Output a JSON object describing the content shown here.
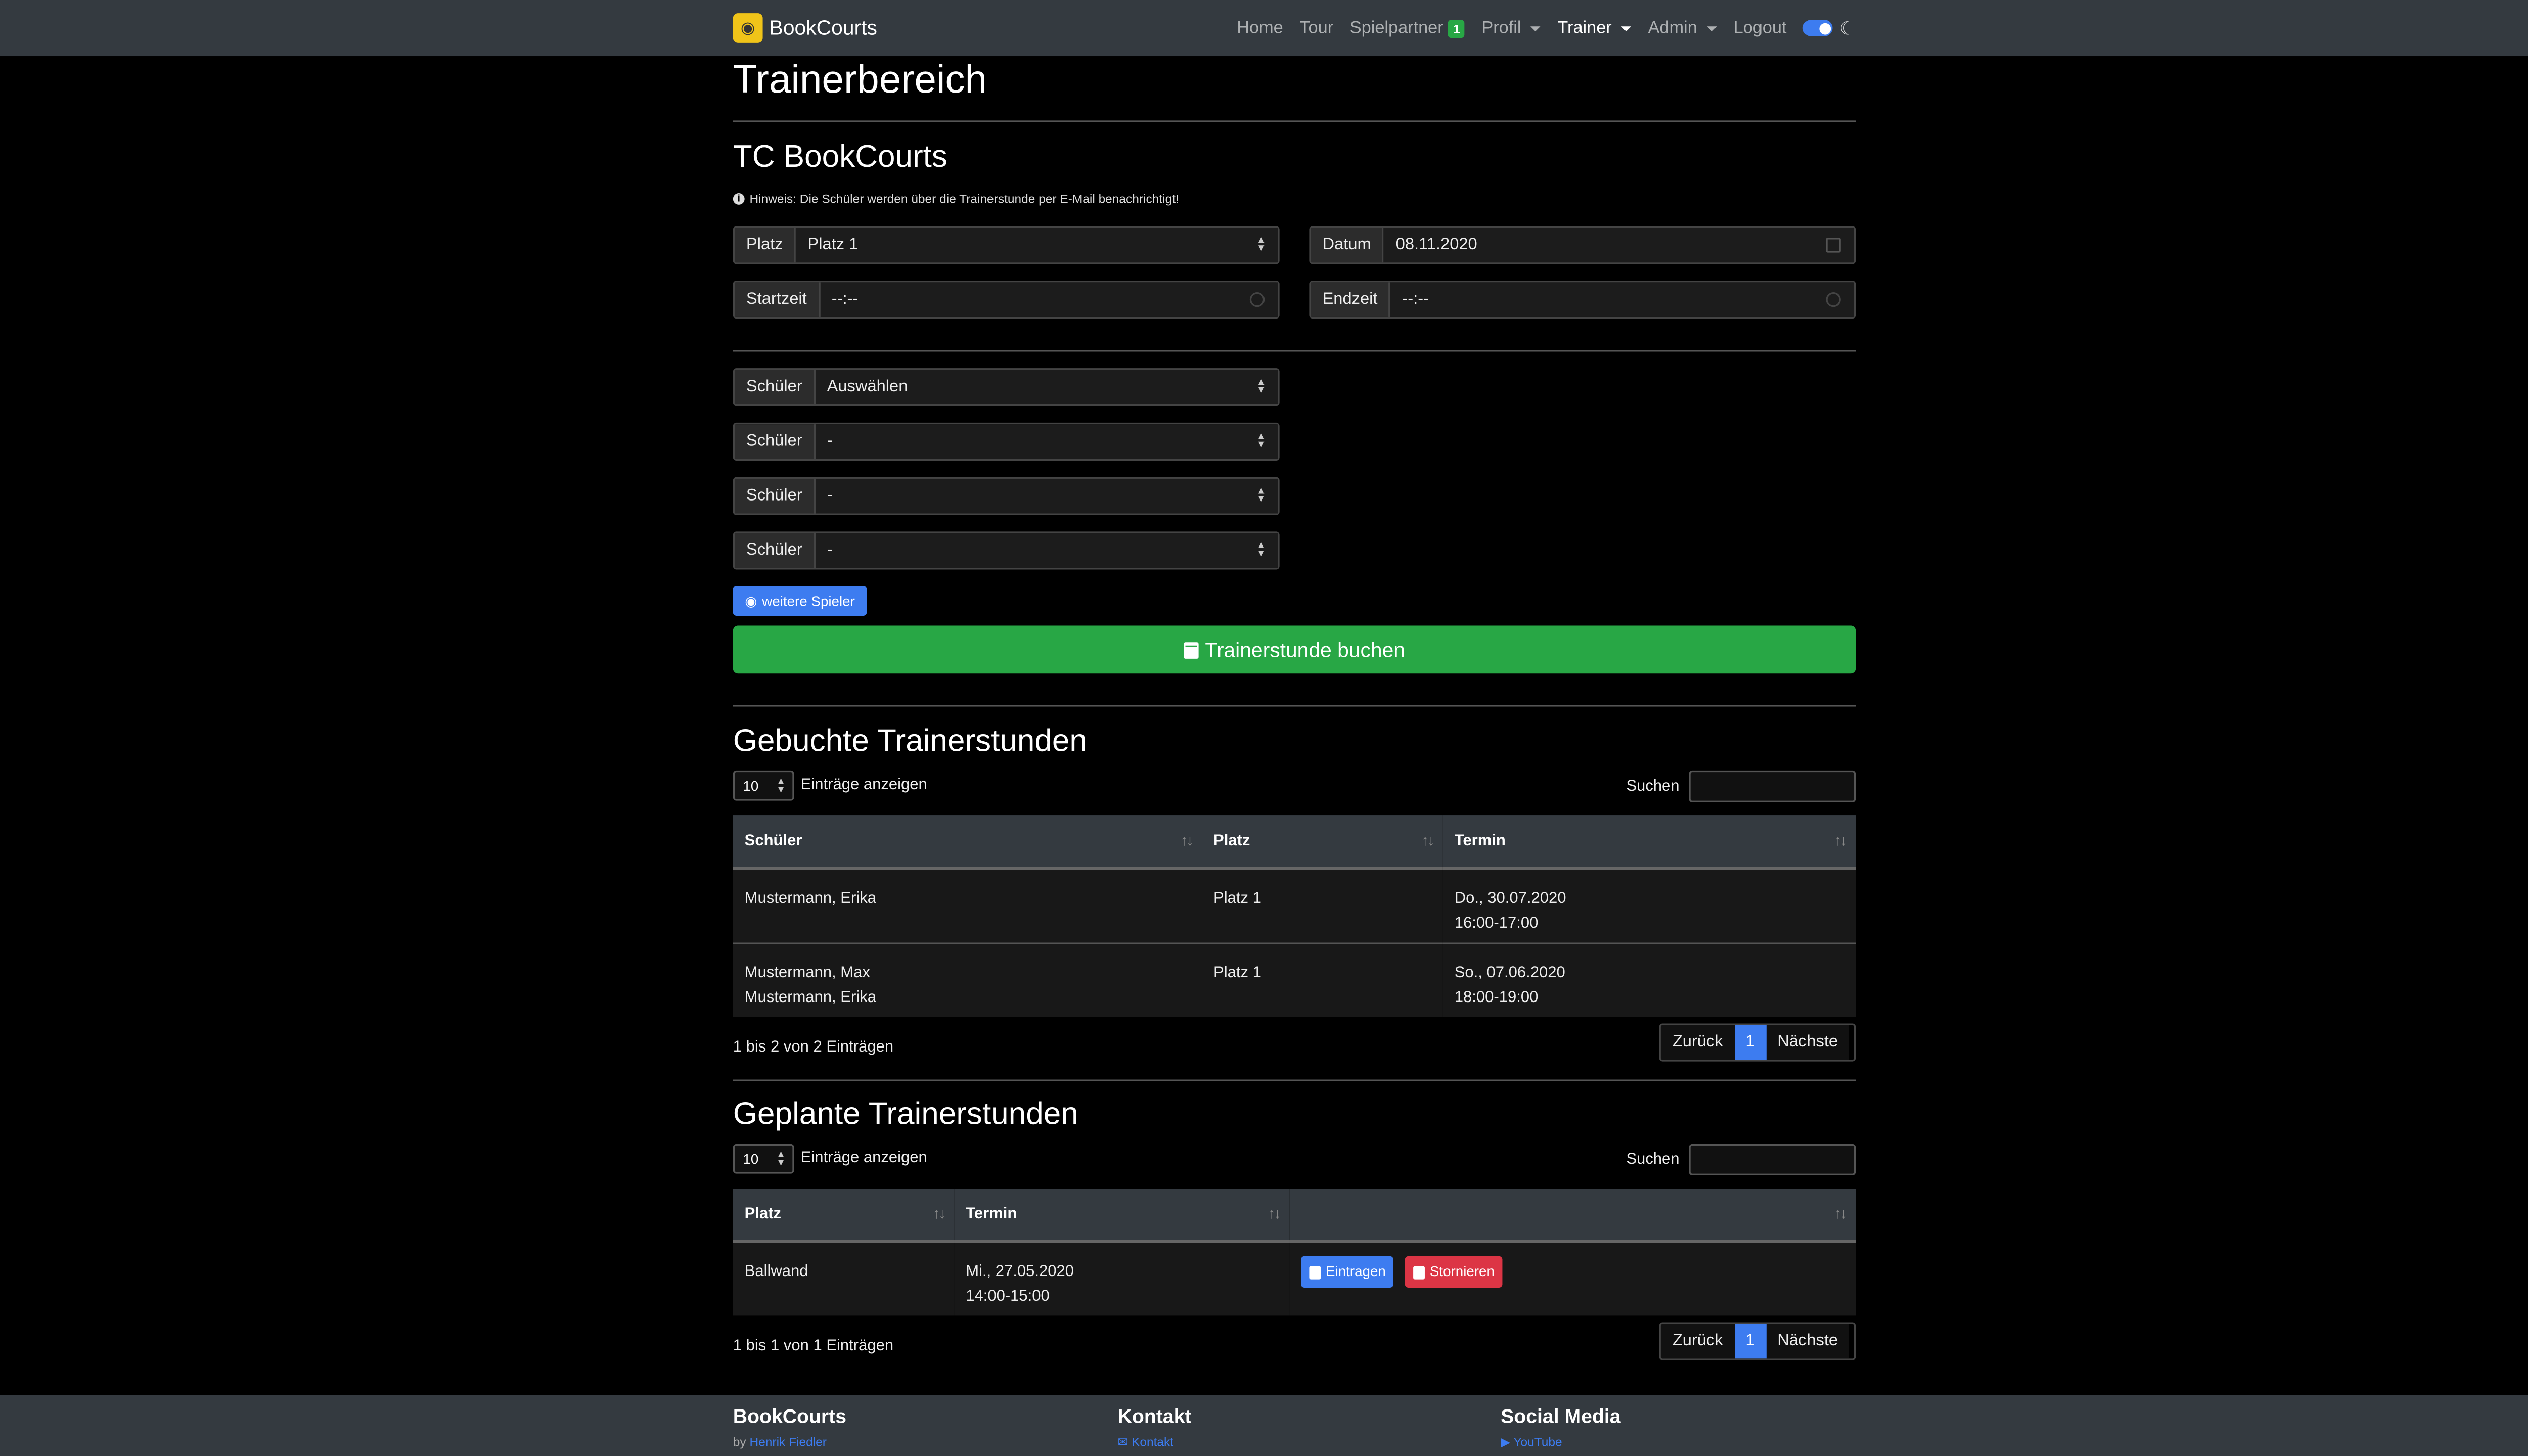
{
  "nav": {
    "brand": "BookCourts",
    "links": [
      {
        "label": "Home"
      },
      {
        "label": "Tour"
      },
      {
        "label": "Spielpartner",
        "badge": "1"
      },
      {
        "label": "Profil"
      },
      {
        "label": "Trainer"
      },
      {
        "label": "Admin"
      },
      {
        "label": "Logout"
      }
    ]
  },
  "page": {
    "title": "Trainerbereich",
    "club": "TC BookCourts",
    "note": "Hinweis: Die Schüler werden über die Trainerstunde per E-Mail benachrichtigt!"
  },
  "form": {
    "platz_label": "Platz",
    "platz_value": "Platz 1",
    "datum_label": "Datum",
    "datum_value": "08.11.2020",
    "start_label": "Startzeit",
    "start_value": "--:--",
    "end_label": "Endzeit",
    "end_value": "--:--",
    "student_label": "Schüler",
    "students": [
      "Auswählen",
      "-",
      "-",
      "-"
    ],
    "more_players": "weitere Spieler",
    "book_button": "Trainerstunde buchen"
  },
  "booked": {
    "title": "Gebuchte Trainerstunden",
    "length": "10",
    "length_label": "Einträge anzeigen",
    "search_label": "Suchen",
    "columns": [
      "Schüler",
      "Platz",
      "Termin"
    ],
    "rows": [
      {
        "students": [
          "Mustermann, Erika"
        ],
        "platz": "Platz 1",
        "date": "Do., 30.07.2020",
        "time": "16:00-17:00"
      },
      {
        "students": [
          "Mustermann, Max",
          "Mustermann, Erika"
        ],
        "platz": "Platz 1",
        "date": "So., 07.06.2020",
        "time": "18:00-19:00"
      }
    ],
    "info": "1 bis 2 von 2 Einträgen",
    "prev": "Zurück",
    "page": "1",
    "next": "Nächste"
  },
  "planned": {
    "title": "Geplante Trainerstunden",
    "length": "10",
    "length_label": "Einträge anzeigen",
    "search_label": "Suchen",
    "columns": [
      "Platz",
      "Termin",
      ""
    ],
    "rows": [
      {
        "platz": "Ballwand",
        "date": "Mi., 27.05.2020",
        "time": "14:00-15:00",
        "btn_enter": "Eintragen",
        "btn_cancel": "Stornieren"
      }
    ],
    "info": "1 bis 1 von 1 Einträgen",
    "prev": "Zurück",
    "page": "1",
    "next": "Nächste"
  },
  "footer": {
    "col1_title": "BookCourts",
    "col1_prefix": "by",
    "col1_link": "Henrik Fiedler",
    "col2_title": "Kontakt",
    "col2_link": "Kontakt",
    "col3_title": "Social Media",
    "col3_link": "YouTube"
  },
  "colors": {
    "primary": "#3d7cf0",
    "success": "#28a745",
    "danger": "#dc3545",
    "navbar": "#343a40"
  }
}
